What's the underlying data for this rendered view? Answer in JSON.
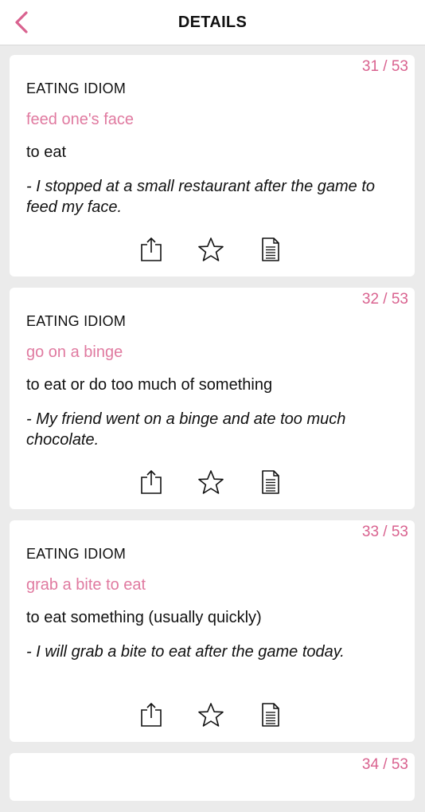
{
  "header": {
    "title": "DETAILS",
    "back_icon": "chevron-left-icon",
    "accent_color": "#d9628f"
  },
  "cards": [
    {
      "counter": "31 / 53",
      "category": "EATING IDIOM",
      "idiom": "feed one's face",
      "meaning": "to eat",
      "example": "- I stopped at a small restaurant after the game to feed my face."
    },
    {
      "counter": "32 / 53",
      "category": "EATING IDIOM",
      "idiom": "go on a binge",
      "meaning": "to eat or do too much of something",
      "example": "- My friend went on a binge and ate too much chocolate."
    },
    {
      "counter": "33 / 53",
      "category": "EATING IDIOM",
      "idiom": "grab a bite to eat",
      "meaning": "to eat something (usually quickly)",
      "example": "- I will grab a bite to eat after the game today."
    },
    {
      "counter": "34 / 53"
    }
  ],
  "actions": {
    "share_icon": "share-icon",
    "favorite_icon": "star-icon",
    "notes_icon": "document-icon"
  }
}
